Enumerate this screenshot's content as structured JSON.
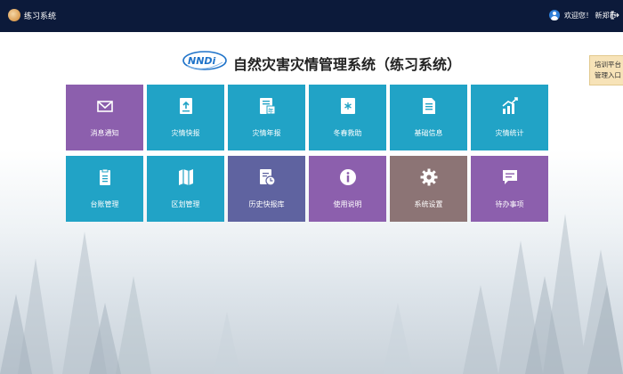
{
  "topbar": {
    "app_title": "练习系统",
    "welcome": "欢迎您！ 新郑市"
  },
  "header": {
    "logo_text": "NNDi",
    "title": "自然灾害灾情管理系统（练习系统）"
  },
  "train_link": {
    "line1": "培训平台",
    "line2": "管理入口"
  },
  "colors": {
    "topbar": "#0c1a3a",
    "purple": "#8c5fad",
    "teal": "#21a3c6",
    "indigo": "#5f63a0",
    "brown": "#8c7475"
  },
  "tiles": [
    {
      "label": "消息通知",
      "icon": "mail-icon",
      "color": "#8c5fad"
    },
    {
      "label": "灾情快报",
      "icon": "upload-doc-icon",
      "color": "#21a3c6"
    },
    {
      "label": "灾情年报",
      "icon": "year-report-icon",
      "color": "#21a3c6"
    },
    {
      "label": "冬春救助",
      "icon": "snowflake-doc-icon",
      "color": "#21a3c6"
    },
    {
      "label": "基础信息",
      "icon": "document-icon",
      "color": "#21a3c6"
    },
    {
      "label": "灾情统计",
      "icon": "stats-chart-icon",
      "color": "#21a3c6"
    },
    {
      "label": "台账管理",
      "icon": "clipboard-icon",
      "color": "#21a3c6"
    },
    {
      "label": "区划管理",
      "icon": "map-icon",
      "color": "#21a3c6"
    },
    {
      "label": "历史快报库",
      "icon": "history-doc-icon",
      "color": "#5f63a0"
    },
    {
      "label": "使用说明",
      "icon": "info-icon",
      "color": "#8c5fad"
    },
    {
      "label": "系统设置",
      "icon": "gear-icon",
      "color": "#8c7475"
    },
    {
      "label": "待办事项",
      "icon": "todo-message-icon",
      "color": "#8c5fad"
    }
  ]
}
